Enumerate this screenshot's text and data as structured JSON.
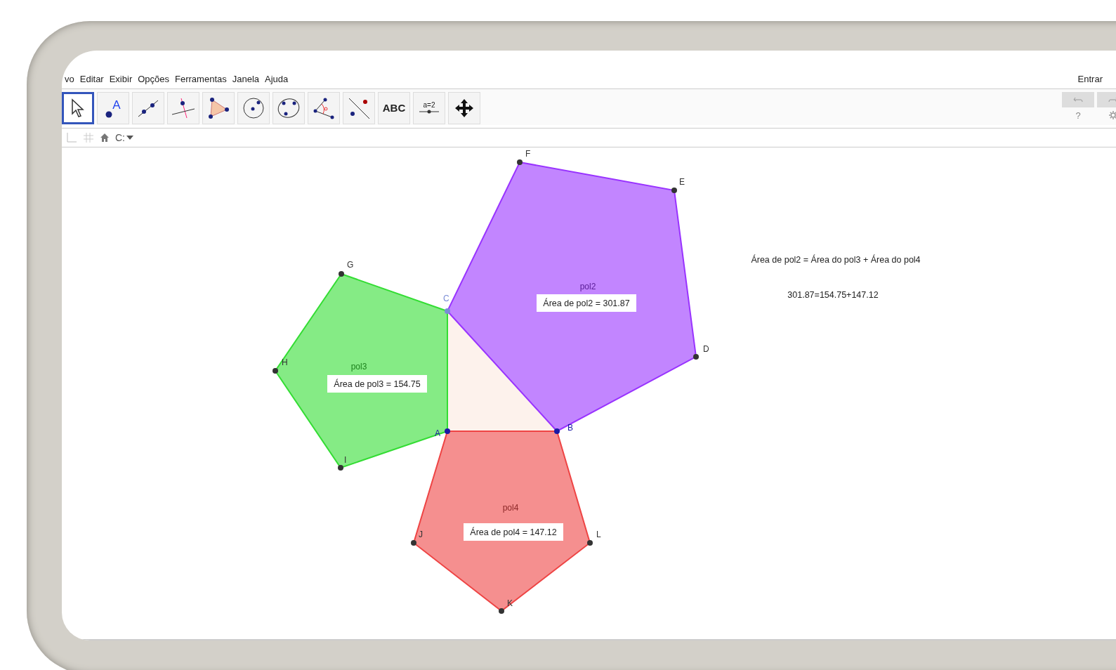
{
  "menu": [
    {
      "label": "vo"
    },
    {
      "label": "Editar"
    },
    {
      "label": "Exibir"
    },
    {
      "label": "Opções"
    },
    {
      "label": "Ferramentas"
    },
    {
      "label": "Janela"
    },
    {
      "label": "Ajuda"
    }
  ],
  "sign_in": "Entrar",
  "tools": [
    {
      "kind": "move",
      "selected": true
    },
    {
      "kind": "point",
      "text": "A",
      "selected": false
    },
    {
      "kind": "line",
      "selected": false
    },
    {
      "kind": "perpendicular",
      "selected": false
    },
    {
      "kind": "polygon",
      "selected": false
    },
    {
      "kind": "circle",
      "selected": false
    },
    {
      "kind": "conic",
      "selected": false
    },
    {
      "kind": "angle",
      "selected": false
    },
    {
      "kind": "reflect",
      "selected": false
    },
    {
      "kind": "text",
      "text": "ABC",
      "selected": false
    },
    {
      "kind": "slider",
      "text": "a=2",
      "selected": false
    },
    {
      "kind": "pan",
      "selected": false
    }
  ],
  "help": "?",
  "style_bar": {
    "font_label": "C:"
  },
  "polygons": [
    {
      "name": "pol2",
      "color": "#9933ff",
      "area_label": "Área de pol2 = 301.87"
    },
    {
      "name": "pol3",
      "color": "#33dd33",
      "area_label": "Área de pol3 = 154.75"
    },
    {
      "name": "pol4",
      "color": "#ee4444",
      "area_label": "Área de pol4 = 147.12"
    }
  ],
  "points": [
    {
      "label": "F",
      "color": "#333333"
    },
    {
      "label": "E",
      "color": "#333333"
    },
    {
      "label": "D",
      "color": "#333333"
    },
    {
      "label": "C",
      "color": "#7a8cd6"
    },
    {
      "label": "B",
      "color": "#1a1aa6"
    },
    {
      "label": "G",
      "color": "#333333"
    },
    {
      "label": "H",
      "color": "#333333"
    },
    {
      "label": "I",
      "color": "#333333"
    },
    {
      "label": "A",
      "color": "#1a1aa6"
    },
    {
      "label": "J",
      "color": "#333333"
    },
    {
      "label": "K",
      "color": "#333333"
    },
    {
      "label": "L",
      "color": "#333333"
    }
  ],
  "texts": [
    "Área de pol2 = Área do pol3 + Área do pol4",
    "301.87=154.75+147.12"
  ]
}
